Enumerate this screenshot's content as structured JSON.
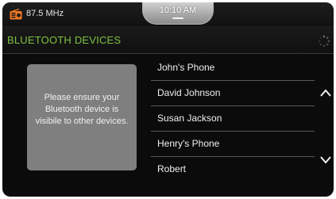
{
  "status": {
    "frequency": "87.5 MHz",
    "time": "10:10 AM",
    "radio_icon": "radio-icon"
  },
  "header": {
    "title": "BLUETOOTH DEVICES",
    "spinner_icon": "loading-spinner-icon"
  },
  "message": "Please ensure your Bluetooth device is visibile to other devices.",
  "devices": [
    "John's Phone",
    "David Johnson",
    "Susan Jackson",
    "Henry's Phone",
    "Robert"
  ],
  "colors": {
    "accent": "#7cc242",
    "radio_icon": "#ee7722",
    "background": "#0b0b0b",
    "message_box": "#7f7f7f"
  }
}
